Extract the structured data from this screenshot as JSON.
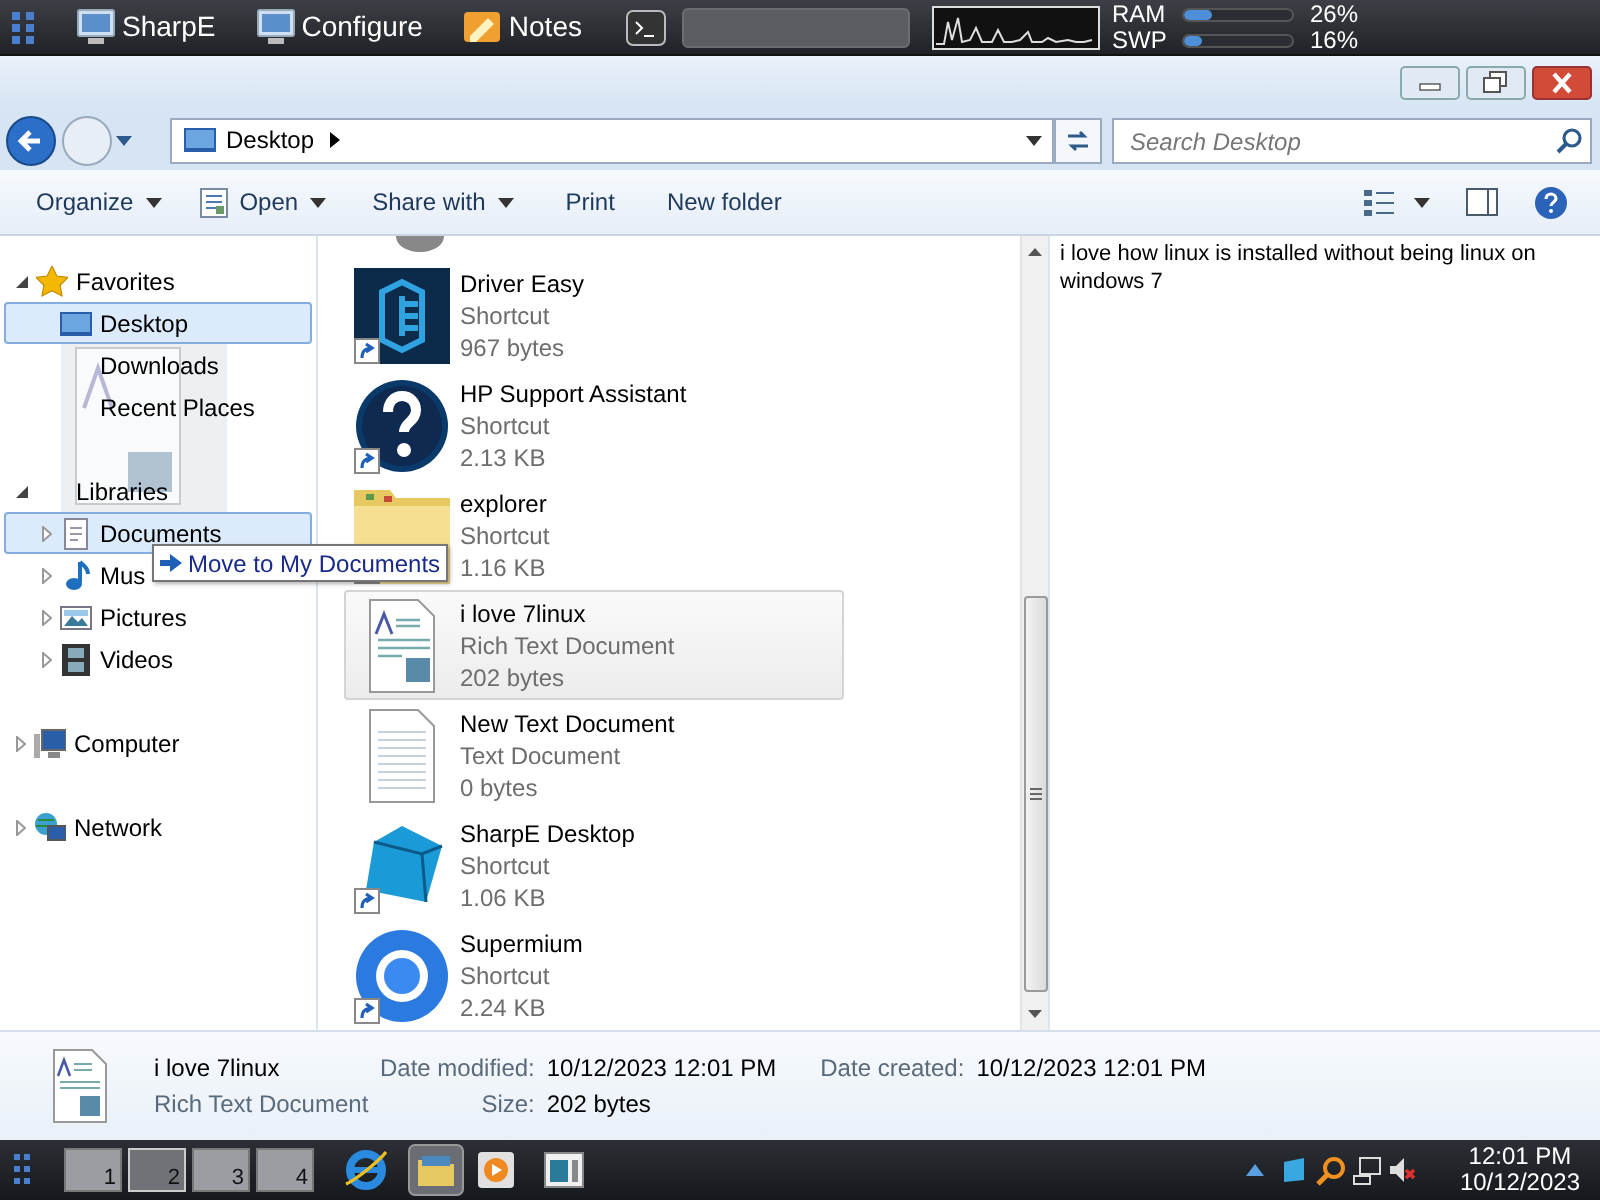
{
  "top_panel": {
    "launchers": [
      {
        "label": "SharpE"
      },
      {
        "label": "Configure"
      },
      {
        "label": "Notes"
      }
    ],
    "meters": [
      {
        "label": "RAM",
        "level": 0.26,
        "reading": "26%"
      },
      {
        "label": "SWP",
        "level": 0.16,
        "reading": "16%"
      }
    ]
  },
  "address_bar": {
    "location": "Desktop"
  },
  "search": {
    "placeholder": "Search Desktop"
  },
  "toolbar": [
    {
      "label": "Organize",
      "dropdown": true,
      "icon": false
    },
    {
      "label": "Open",
      "dropdown": true,
      "icon": true
    },
    {
      "label": "Share with",
      "dropdown": true,
      "icon": false
    },
    {
      "label": "Print",
      "dropdown": false,
      "icon": false
    },
    {
      "label": "New folder",
      "dropdown": false,
      "icon": false
    }
  ],
  "nav_pane": [
    {
      "label": "Favorites",
      "kind": "star",
      "expanded": true,
      "children": [
        {
          "label": "Desktop",
          "kind": "desktop",
          "selected": true
        },
        {
          "label": "Downloads",
          "kind": "plain",
          "selected": false
        },
        {
          "label": "Recent Places",
          "kind": "plain",
          "selected": false
        }
      ]
    },
    {
      "label": "Libraries",
      "kind": "plain",
      "expanded": true,
      "children": [
        {
          "label": "Documents",
          "kind": "document",
          "selected": true,
          "expanded": false
        },
        {
          "label": "Mus",
          "kind": "music",
          "selected": false,
          "expanded": false
        },
        {
          "label": "Pictures",
          "kind": "picture",
          "selected": false,
          "expanded": false
        },
        {
          "label": "Videos",
          "kind": "video",
          "selected": false,
          "expanded": false
        }
      ]
    },
    {
      "label": "Computer",
      "kind": "computer",
      "expanded": false
    },
    {
      "label": "Network",
      "kind": "network",
      "expanded": false
    }
  ],
  "drag_tooltip": {
    "text": "Move to My Documents"
  },
  "files": [
    {
      "name": "Driver Easy",
      "type": "Shortcut",
      "size": "967 bytes",
      "kind": "driver",
      "shortcut": true,
      "selected": false
    },
    {
      "name": "HP Support Assistant",
      "type": "Shortcut",
      "size": "2.13 KB",
      "kind": "help",
      "shortcut": true,
      "selected": false
    },
    {
      "name": "explorer",
      "type": "Shortcut",
      "size": "1.16 KB",
      "kind": "folder",
      "shortcut": true,
      "selected": false
    },
    {
      "name": "i love 7linux",
      "type": "Rich Text Document",
      "size": "202 bytes",
      "kind": "rtf",
      "shortcut": false,
      "selected": true
    },
    {
      "name": "New Text Document",
      "type": "Text Document",
      "size": "0 bytes",
      "kind": "text",
      "shortcut": false,
      "selected": false
    },
    {
      "name": "SharpE Desktop",
      "type": "Shortcut",
      "size": "1.06 KB",
      "kind": "cube",
      "shortcut": true,
      "selected": false
    },
    {
      "name": "Supermium",
      "type": "Shortcut",
      "size": "2.24 KB",
      "kind": "browser",
      "shortcut": true,
      "selected": false
    }
  ],
  "preview": {
    "text": "i love how linux is installed without being linux on windows 7"
  },
  "details": {
    "name": "i love 7linux",
    "type": "Rich Text Document",
    "fields": [
      {
        "label": "Date modified:",
        "value": "10/12/2023 12:01 PM"
      },
      {
        "label": "Date created:",
        "value": "10/12/2023 12:01 PM"
      },
      {
        "label": "Size:",
        "value": "202 bytes"
      }
    ]
  },
  "taskbar": {
    "workspaces": [
      {
        "label": "1",
        "selected": false
      },
      {
        "label": "2",
        "selected": true
      },
      {
        "label": "3",
        "selected": false
      },
      {
        "label": "4",
        "selected": false
      }
    ],
    "clock": {
      "time": "12:01 PM",
      "date": "10/12/2023"
    }
  }
}
